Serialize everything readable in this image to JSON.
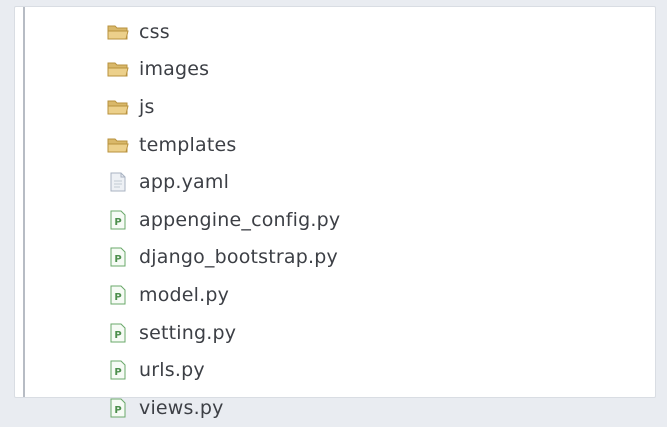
{
  "tree": {
    "items": [
      {
        "label": "css",
        "type": "folder",
        "icon": "folder-icon"
      },
      {
        "label": "images",
        "type": "folder",
        "icon": "folder-icon"
      },
      {
        "label": "js",
        "type": "folder",
        "icon": "folder-icon"
      },
      {
        "label": "templates",
        "type": "folder",
        "icon": "folder-icon"
      },
      {
        "label": "app.yaml",
        "type": "file",
        "icon": "text-file-icon"
      },
      {
        "label": "appengine_config.py",
        "type": "file",
        "icon": "python-file-icon"
      },
      {
        "label": "django_bootstrap.py",
        "type": "file",
        "icon": "python-file-icon"
      },
      {
        "label": "model.py",
        "type": "file",
        "icon": "python-file-icon"
      },
      {
        "label": "setting.py",
        "type": "file",
        "icon": "python-file-icon"
      },
      {
        "label": "urls.py",
        "type": "file",
        "icon": "python-file-icon"
      },
      {
        "label": "views.py",
        "type": "file",
        "icon": "python-file-icon"
      }
    ]
  },
  "colors": {
    "folder": "#d9b86a",
    "folder_dark": "#b8923e",
    "python_file_border": "#6aa86a",
    "python_file_letter": "#4d8f4d",
    "text_file": "#a9b3c2"
  }
}
